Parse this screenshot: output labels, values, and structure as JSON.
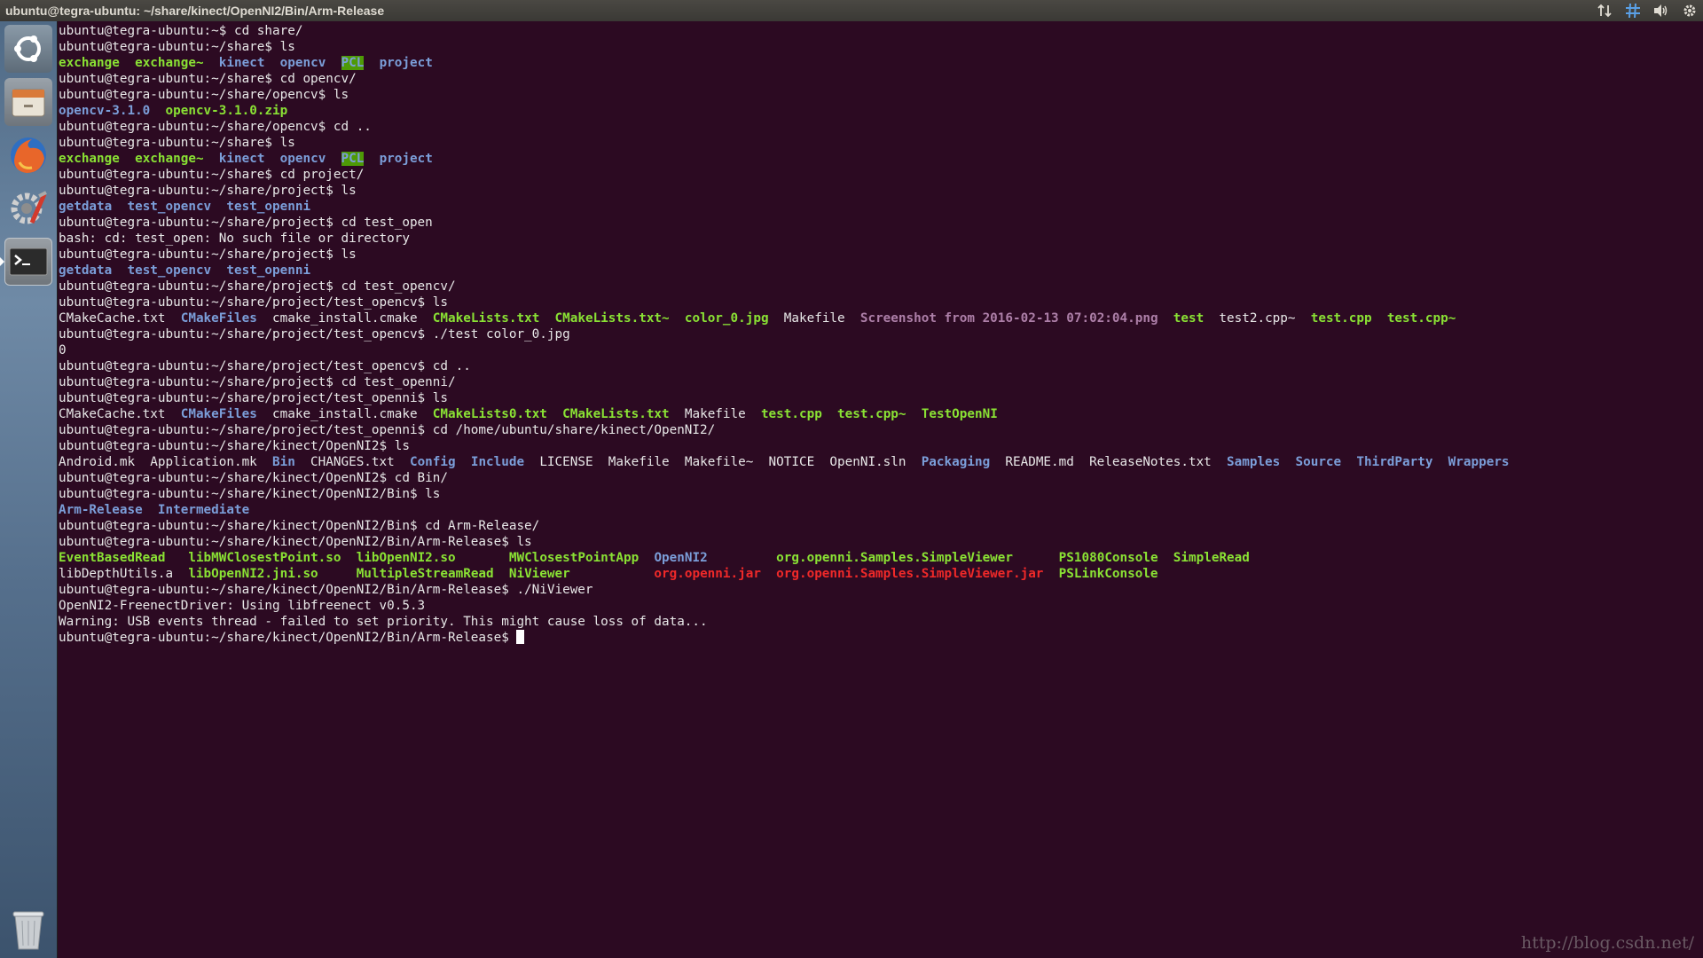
{
  "window": {
    "title": "ubuntu@tegra-ubuntu: ~/share/kinect/OpenNI2/Bin/Arm-Release"
  },
  "indicators": [
    {
      "name": "network-icon",
      "glyph": "⇅"
    },
    {
      "name": "keyboard-layout-icon",
      "glyph": "#"
    },
    {
      "name": "volume-icon",
      "glyph": "🔊"
    },
    {
      "name": "settings-gear-icon",
      "glyph": "⚙"
    }
  ],
  "launcher": [
    {
      "name": "ubuntu-dash-icon"
    },
    {
      "name": "files-icon"
    },
    {
      "name": "firefox-icon"
    },
    {
      "name": "system-settings-icon"
    },
    {
      "name": "terminal-icon"
    }
  ],
  "terminal": {
    "lines": [
      [
        {
          "t": "ubuntu@tegra-ubuntu:~$ cd share/"
        }
      ],
      [
        {
          "t": "ubuntu@tegra-ubuntu:~/share$ ls"
        }
      ],
      [
        {
          "t": "exchange",
          "c": "g"
        },
        {
          "t": "  "
        },
        {
          "t": "exchange~",
          "c": "g"
        },
        {
          "t": "  "
        },
        {
          "t": "kinect",
          "c": "b"
        },
        {
          "t": "  "
        },
        {
          "t": "opencv",
          "c": "b"
        },
        {
          "t": "  "
        },
        {
          "t": "PCL",
          "c": "bg"
        },
        {
          "t": "  "
        },
        {
          "t": "project",
          "c": "b"
        }
      ],
      [
        {
          "t": "ubuntu@tegra-ubuntu:~/share$ cd opencv/"
        }
      ],
      [
        {
          "t": "ubuntu@tegra-ubuntu:~/share/opencv$ ls"
        }
      ],
      [
        {
          "t": "opencv-3.1.0",
          "c": "b"
        },
        {
          "t": "  "
        },
        {
          "t": "opencv-3.1.0.zip",
          "c": "g"
        }
      ],
      [
        {
          "t": "ubuntu@tegra-ubuntu:~/share/opencv$ cd .."
        }
      ],
      [
        {
          "t": "ubuntu@tegra-ubuntu:~/share$ ls"
        }
      ],
      [
        {
          "t": "exchange",
          "c": "g"
        },
        {
          "t": "  "
        },
        {
          "t": "exchange~",
          "c": "g"
        },
        {
          "t": "  "
        },
        {
          "t": "kinect",
          "c": "b"
        },
        {
          "t": "  "
        },
        {
          "t": "opencv",
          "c": "b"
        },
        {
          "t": "  "
        },
        {
          "t": "PCL",
          "c": "bg"
        },
        {
          "t": "  "
        },
        {
          "t": "project",
          "c": "b"
        }
      ],
      [
        {
          "t": "ubuntu@tegra-ubuntu:~/share$ cd project/"
        }
      ],
      [
        {
          "t": "ubuntu@tegra-ubuntu:~/share/project$ ls"
        }
      ],
      [
        {
          "t": "getdata",
          "c": "b"
        },
        {
          "t": "  "
        },
        {
          "t": "test_opencv",
          "c": "b"
        },
        {
          "t": "  "
        },
        {
          "t": "test_openni",
          "c": "b"
        }
      ],
      [
        {
          "t": "ubuntu@tegra-ubuntu:~/share/project$ cd test_open"
        }
      ],
      [
        {
          "t": "bash: cd: test_open: No such file or directory"
        }
      ],
      [
        {
          "t": "ubuntu@tegra-ubuntu:~/share/project$ ls"
        }
      ],
      [
        {
          "t": "getdata",
          "c": "b"
        },
        {
          "t": "  "
        },
        {
          "t": "test_opencv",
          "c": "b"
        },
        {
          "t": "  "
        },
        {
          "t": "test_openni",
          "c": "b"
        }
      ],
      [
        {
          "t": "ubuntu@tegra-ubuntu:~/share/project$ cd test_opencv/"
        }
      ],
      [
        {
          "t": "ubuntu@tegra-ubuntu:~/share/project/test_opencv$ ls"
        }
      ],
      [
        {
          "t": "CMakeCache.txt  "
        },
        {
          "t": "CMakeFiles",
          "c": "b"
        },
        {
          "t": "  cmake_install.cmake  "
        },
        {
          "t": "CMakeLists.txt",
          "c": "g"
        },
        {
          "t": "  "
        },
        {
          "t": "CMakeLists.txt~",
          "c": "g"
        },
        {
          "t": "  "
        },
        {
          "t": "color_0.jpg",
          "c": "g"
        },
        {
          "t": "  Makefile  "
        },
        {
          "t": "Screenshot from 2016-02-13 07:02:04.png",
          "c": "m"
        },
        {
          "t": "  "
        },
        {
          "t": "test",
          "c": "g"
        },
        {
          "t": "  test2.cpp~  "
        },
        {
          "t": "test.cpp",
          "c": "g"
        },
        {
          "t": "  "
        },
        {
          "t": "test.cpp~",
          "c": "g"
        }
      ],
      [
        {
          "t": "ubuntu@tegra-ubuntu:~/share/project/test_opencv$ ./test color_0.jpg"
        }
      ],
      [
        {
          "t": "0"
        }
      ],
      [
        {
          "t": "ubuntu@tegra-ubuntu:~/share/project/test_opencv$ cd .."
        }
      ],
      [
        {
          "t": "ubuntu@tegra-ubuntu:~/share/project$ cd test_openni/"
        }
      ],
      [
        {
          "t": "ubuntu@tegra-ubuntu:~/share/project/test_openni$ ls"
        }
      ],
      [
        {
          "t": "CMakeCache.txt  "
        },
        {
          "t": "CMakeFiles",
          "c": "b"
        },
        {
          "t": "  cmake_install.cmake  "
        },
        {
          "t": "CMakeLists0.txt",
          "c": "g"
        },
        {
          "t": "  "
        },
        {
          "t": "CMakeLists.txt",
          "c": "g"
        },
        {
          "t": "  Makefile  "
        },
        {
          "t": "test.cpp",
          "c": "g"
        },
        {
          "t": "  "
        },
        {
          "t": "test.cpp~",
          "c": "g"
        },
        {
          "t": "  "
        },
        {
          "t": "TestOpenNI",
          "c": "g"
        }
      ],
      [
        {
          "t": "ubuntu@tegra-ubuntu:~/share/project/test_openni$ cd /home/ubuntu/share/kinect/OpenNI2/"
        }
      ],
      [
        {
          "t": "ubuntu@tegra-ubuntu:~/share/kinect/OpenNI2$ ls"
        }
      ],
      [
        {
          "t": "Android.mk  Application.mk  "
        },
        {
          "t": "Bin",
          "c": "b"
        },
        {
          "t": "  CHANGES.txt  "
        },
        {
          "t": "Config",
          "c": "b"
        },
        {
          "t": "  "
        },
        {
          "t": "Include",
          "c": "b"
        },
        {
          "t": "  LICENSE  Makefile  Makefile~  NOTICE  OpenNI.sln  "
        },
        {
          "t": "Packaging",
          "c": "b"
        },
        {
          "t": "  README.md  ReleaseNotes.txt  "
        },
        {
          "t": "Samples",
          "c": "b"
        },
        {
          "t": "  "
        },
        {
          "t": "Source",
          "c": "b"
        },
        {
          "t": "  "
        },
        {
          "t": "ThirdParty",
          "c": "b"
        },
        {
          "t": "  "
        },
        {
          "t": "Wrappers",
          "c": "b"
        }
      ],
      [
        {
          "t": "ubuntu@tegra-ubuntu:~/share/kinect/OpenNI2$ cd Bin/"
        }
      ],
      [
        {
          "t": "ubuntu@tegra-ubuntu:~/share/kinect/OpenNI2/Bin$ ls"
        }
      ],
      [
        {
          "t": "Arm-Release",
          "c": "b"
        },
        {
          "t": "  "
        },
        {
          "t": "Intermediate",
          "c": "b"
        }
      ],
      [
        {
          "t": "ubuntu@tegra-ubuntu:~/share/kinect/OpenNI2/Bin$ cd Arm-Release/"
        }
      ],
      [
        {
          "t": "ubuntu@tegra-ubuntu:~/share/kinect/OpenNI2/Bin/Arm-Release$ ls"
        }
      ],
      [
        {
          "t": "EventBasedRead",
          "c": "g"
        },
        {
          "t": "   "
        },
        {
          "t": "libMWClosestPoint.so",
          "c": "g"
        },
        {
          "t": "  "
        },
        {
          "t": "libOpenNI2.so",
          "c": "g"
        },
        {
          "t": "       "
        },
        {
          "t": "MWClosestPointApp",
          "c": "g"
        },
        {
          "t": "  "
        },
        {
          "t": "OpenNI2",
          "c": "b"
        },
        {
          "t": "         "
        },
        {
          "t": "org.openni.Samples.SimpleViewer",
          "c": "g"
        },
        {
          "t": "      "
        },
        {
          "t": "PS1080Console",
          "c": "g"
        },
        {
          "t": "  "
        },
        {
          "t": "SimpleRead",
          "c": "g"
        }
      ],
      [
        {
          "t": "libDepthUtils.a  "
        },
        {
          "t": "libOpenNI2.jni.so",
          "c": "g"
        },
        {
          "t": "     "
        },
        {
          "t": "MultipleStreamRead",
          "c": "g"
        },
        {
          "t": "  "
        },
        {
          "t": "NiViewer",
          "c": "g"
        },
        {
          "t": "           "
        },
        {
          "t": "org.openni.jar",
          "c": "r"
        },
        {
          "t": "  "
        },
        {
          "t": "org.openni.Samples.SimpleViewer.jar",
          "c": "r"
        },
        {
          "t": "  "
        },
        {
          "t": "PSLinkConsole",
          "c": "g"
        }
      ],
      [
        {
          "t": "ubuntu@tegra-ubuntu:~/share/kinect/OpenNI2/Bin/Arm-Release$ ./NiViewer"
        }
      ],
      [
        {
          "t": "OpenNI2-FreenectDriver: Using libfreenect v0.5.3"
        }
      ],
      [
        {
          "t": "Warning: USB events thread - failed to set priority. This might cause loss of data..."
        }
      ],
      [
        {
          "t": "ubuntu@tegra-ubuntu:~/share/kinect/OpenNI2/Bin/Arm-Release$ "
        },
        {
          "cursor": true
        }
      ]
    ]
  },
  "watermark": "http://blog.csdn.net/"
}
